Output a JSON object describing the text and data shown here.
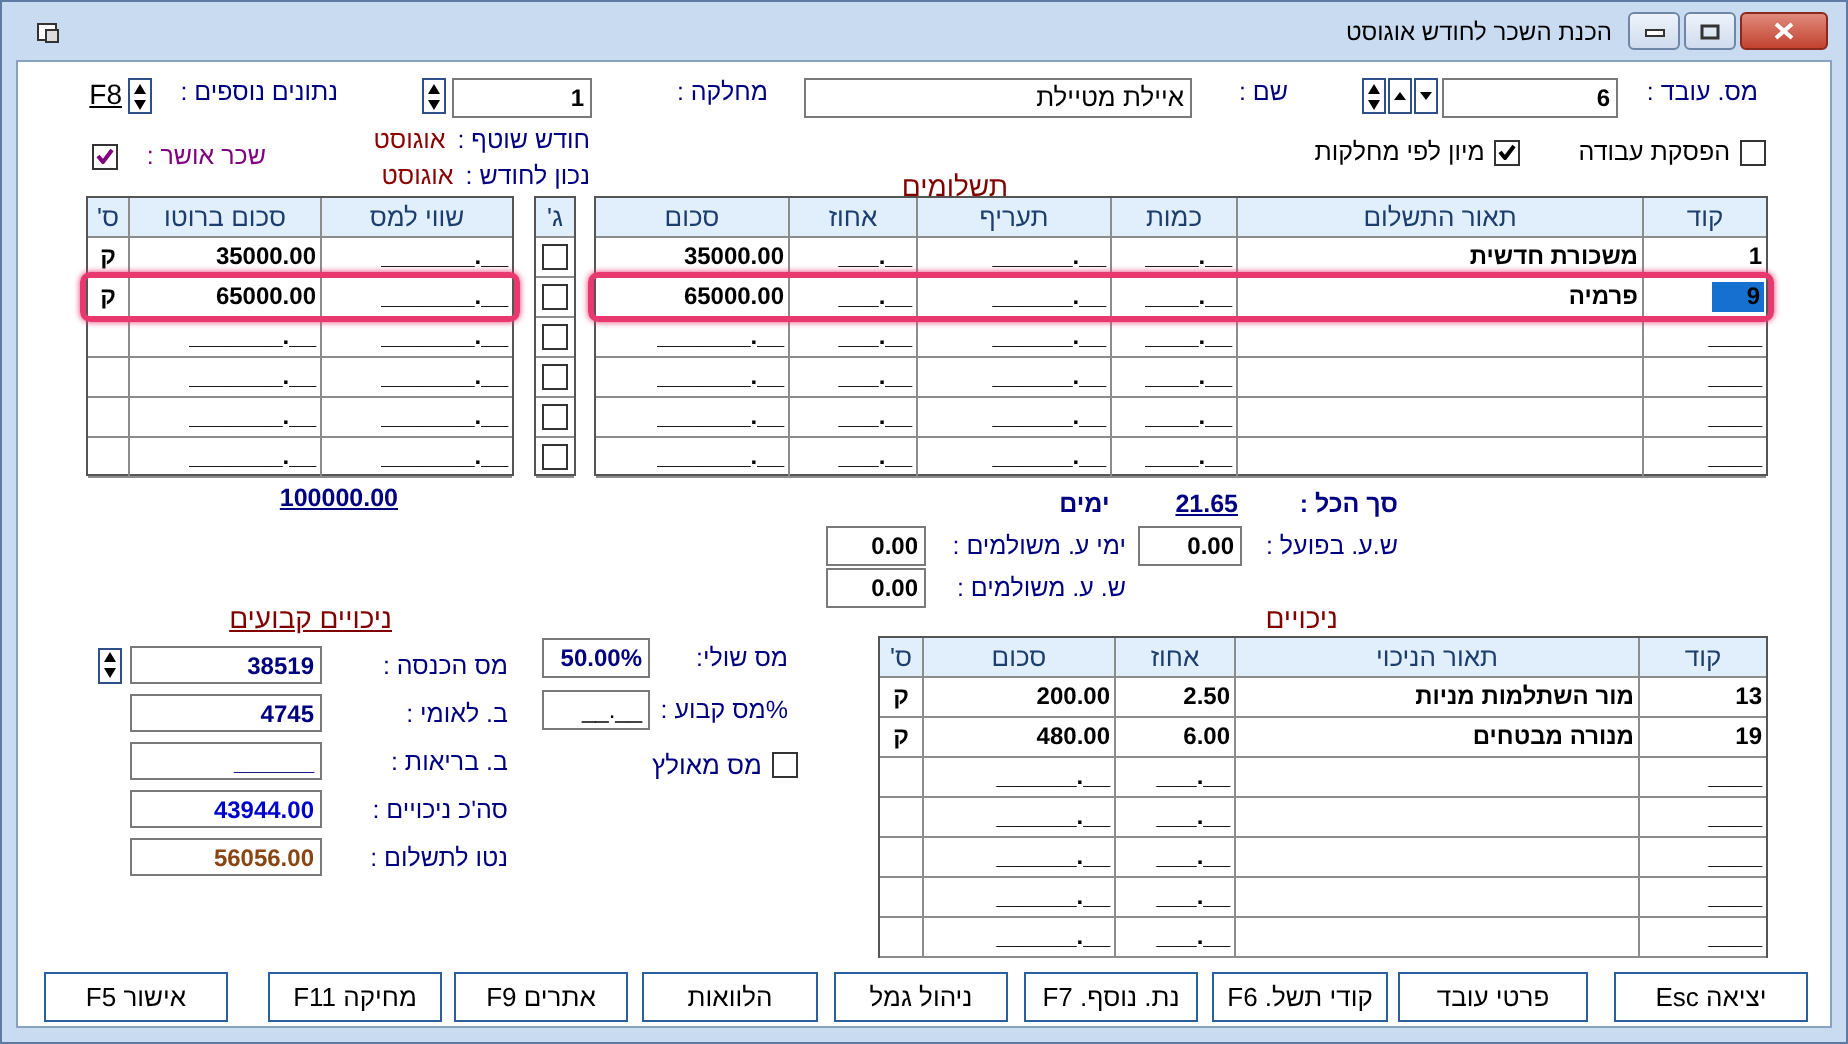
{
  "window": {
    "title": "הכנת השכר לחודש אוגוסט"
  },
  "employee": {
    "label": "מס. עובד :",
    "value": "6"
  },
  "name": {
    "label": "שם :",
    "value": "איילת מטיילת"
  },
  "department": {
    "label": "מחלקה :",
    "value": "1"
  },
  "extra_data": {
    "label": "נתונים נוספים :",
    "key": "F8"
  },
  "options": [
    {
      "label": "הפסקת עבודה",
      "checked": false
    },
    {
      "label": "מיון לפי מחלקות",
      "checked": true
    }
  ],
  "month_info": [
    {
      "label": "חודש שוטף :",
      "value": "אוגוסט"
    },
    {
      "label": "נכון לחודש :",
      "value": "אוגוסט"
    }
  ],
  "approved_salary": {
    "label": "שכר אושר :",
    "checked": true
  },
  "payments": {
    "title": "תשלומים",
    "columns": [
      "קוד",
      "תאור התשלום",
      "כמות",
      "תעריף",
      "אחוז",
      "סכום"
    ],
    "side_columns": [
      "ג'",
      "שווי למס",
      "סכום ברוטו",
      "ס'"
    ],
    "rows": [
      {
        "code": "1",
        "description": "משכורת חדשית",
        "quantity": "____.__",
        "rate": "______.__",
        "percent": "___.__",
        "amount": "35000.00",
        "g": false,
        "tax_value": "_______.__",
        "gross": "35000.00",
        "s": "ק",
        "selected": false,
        "focused": false
      },
      {
        "code": "9",
        "description": "פרמיה",
        "quantity": "____.__",
        "rate": "______.__",
        "percent": "___.__",
        "amount": "65000.00",
        "g": false,
        "tax_value": "_______.__",
        "gross": "65000.00",
        "s": "ק",
        "selected": true,
        "focused": true
      },
      {
        "code": "____",
        "quantity": "____.__",
        "rate": "______.__",
        "percent": "___.__",
        "amount": "_______.__",
        "g": false,
        "tax_value": "_______.__",
        "gross": "_______.__",
        "selected": false,
        "focused": false
      },
      {
        "code": "____",
        "quantity": "____.__",
        "rate": "______.__",
        "percent": "___.__",
        "amount": "_______.__",
        "g": false,
        "tax_value": "_______.__",
        "gross": "_______.__",
        "selected": false,
        "focused": false
      },
      {
        "code": "____",
        "quantity": "____.__",
        "rate": "______.__",
        "percent": "___.__",
        "amount": "_______.__",
        "g": false,
        "tax_value": "_______.__",
        "gross": "_______.__",
        "selected": false,
        "focused": false
      },
      {
        "code": "____",
        "quantity": "____.__",
        "rate": "______.__",
        "percent": "___.__",
        "amount": "_______.__",
        "g": false,
        "tax_value": "_______.__",
        "gross": "_______.__",
        "selected": false,
        "focused": false
      }
    ],
    "gross_total": "100000.00"
  },
  "summary": {
    "total_label": "סך הכל :",
    "total_value": "21.65",
    "days_label": "ימים",
    "actual_hours": {
      "label": "ש.ע. בפועל :",
      "value": "0.00"
    },
    "paid_days": {
      "label": "ימי ע. משולמים :",
      "value": "0.00"
    },
    "paid_hours": {
      "label": "ש. ע. משולמים :",
      "value": "0.00"
    }
  },
  "deductions": {
    "title": "ניכויים",
    "columns": [
      "קוד",
      "תאור הניכוי",
      "אחוז",
      "סכום",
      "ס'"
    ],
    "rows": [
      {
        "code": "13",
        "description": "מור השתלמות מניות",
        "percent": "2.50",
        "amount": "200.00",
        "s": "ק"
      },
      {
        "code": "19",
        "description": "מנורה מבטחים",
        "percent": "6.00",
        "amount": "480.00",
        "s": "ק"
      },
      {
        "code": "____",
        "percent": "___.__",
        "amount": "______.__"
      },
      {
        "code": "____",
        "percent": "___.__",
        "amount": "______.__"
      },
      {
        "code": "____",
        "percent": "___.__",
        "amount": "______.__"
      },
      {
        "code": "____",
        "percent": "___.__",
        "amount": "______.__"
      },
      {
        "code": "____",
        "percent": "___.__",
        "amount": "______.__"
      }
    ]
  },
  "tax": {
    "marginal": {
      "label": "מס שולי:",
      "value": "50.00%"
    },
    "fixed": {
      "label": "%מס קבוע :",
      "value": "__.__"
    },
    "forced": {
      "label": "מס מאולץ",
      "checked": false
    }
  },
  "fixed_deductions": {
    "title": "ניכויים קבועים",
    "fields": [
      {
        "label": "מס הכנסה :",
        "value": "38519",
        "color": "#000080"
      },
      {
        "label": "ב. לאומי :",
        "value": "4745",
        "color": "#000080"
      },
      {
        "label": "ב. בריאות :",
        "value": "______"
      },
      {
        "label": "סה'כ ניכויים :",
        "value": "43944.00",
        "color": "#0000cc"
      },
      {
        "label": "נטו לתשלום :",
        "value": "56056.00",
        "color": "#8b4513"
      }
    ]
  },
  "buttons": [
    "יציאה Esc",
    "פרטי עובד",
    "קודי תשל. F6",
    "נת. נוסף. F7",
    "ניהול גמל",
    "הלוואות",
    "אתרים F9",
    "מחיקה F11",
    "אישור F5"
  ]
}
